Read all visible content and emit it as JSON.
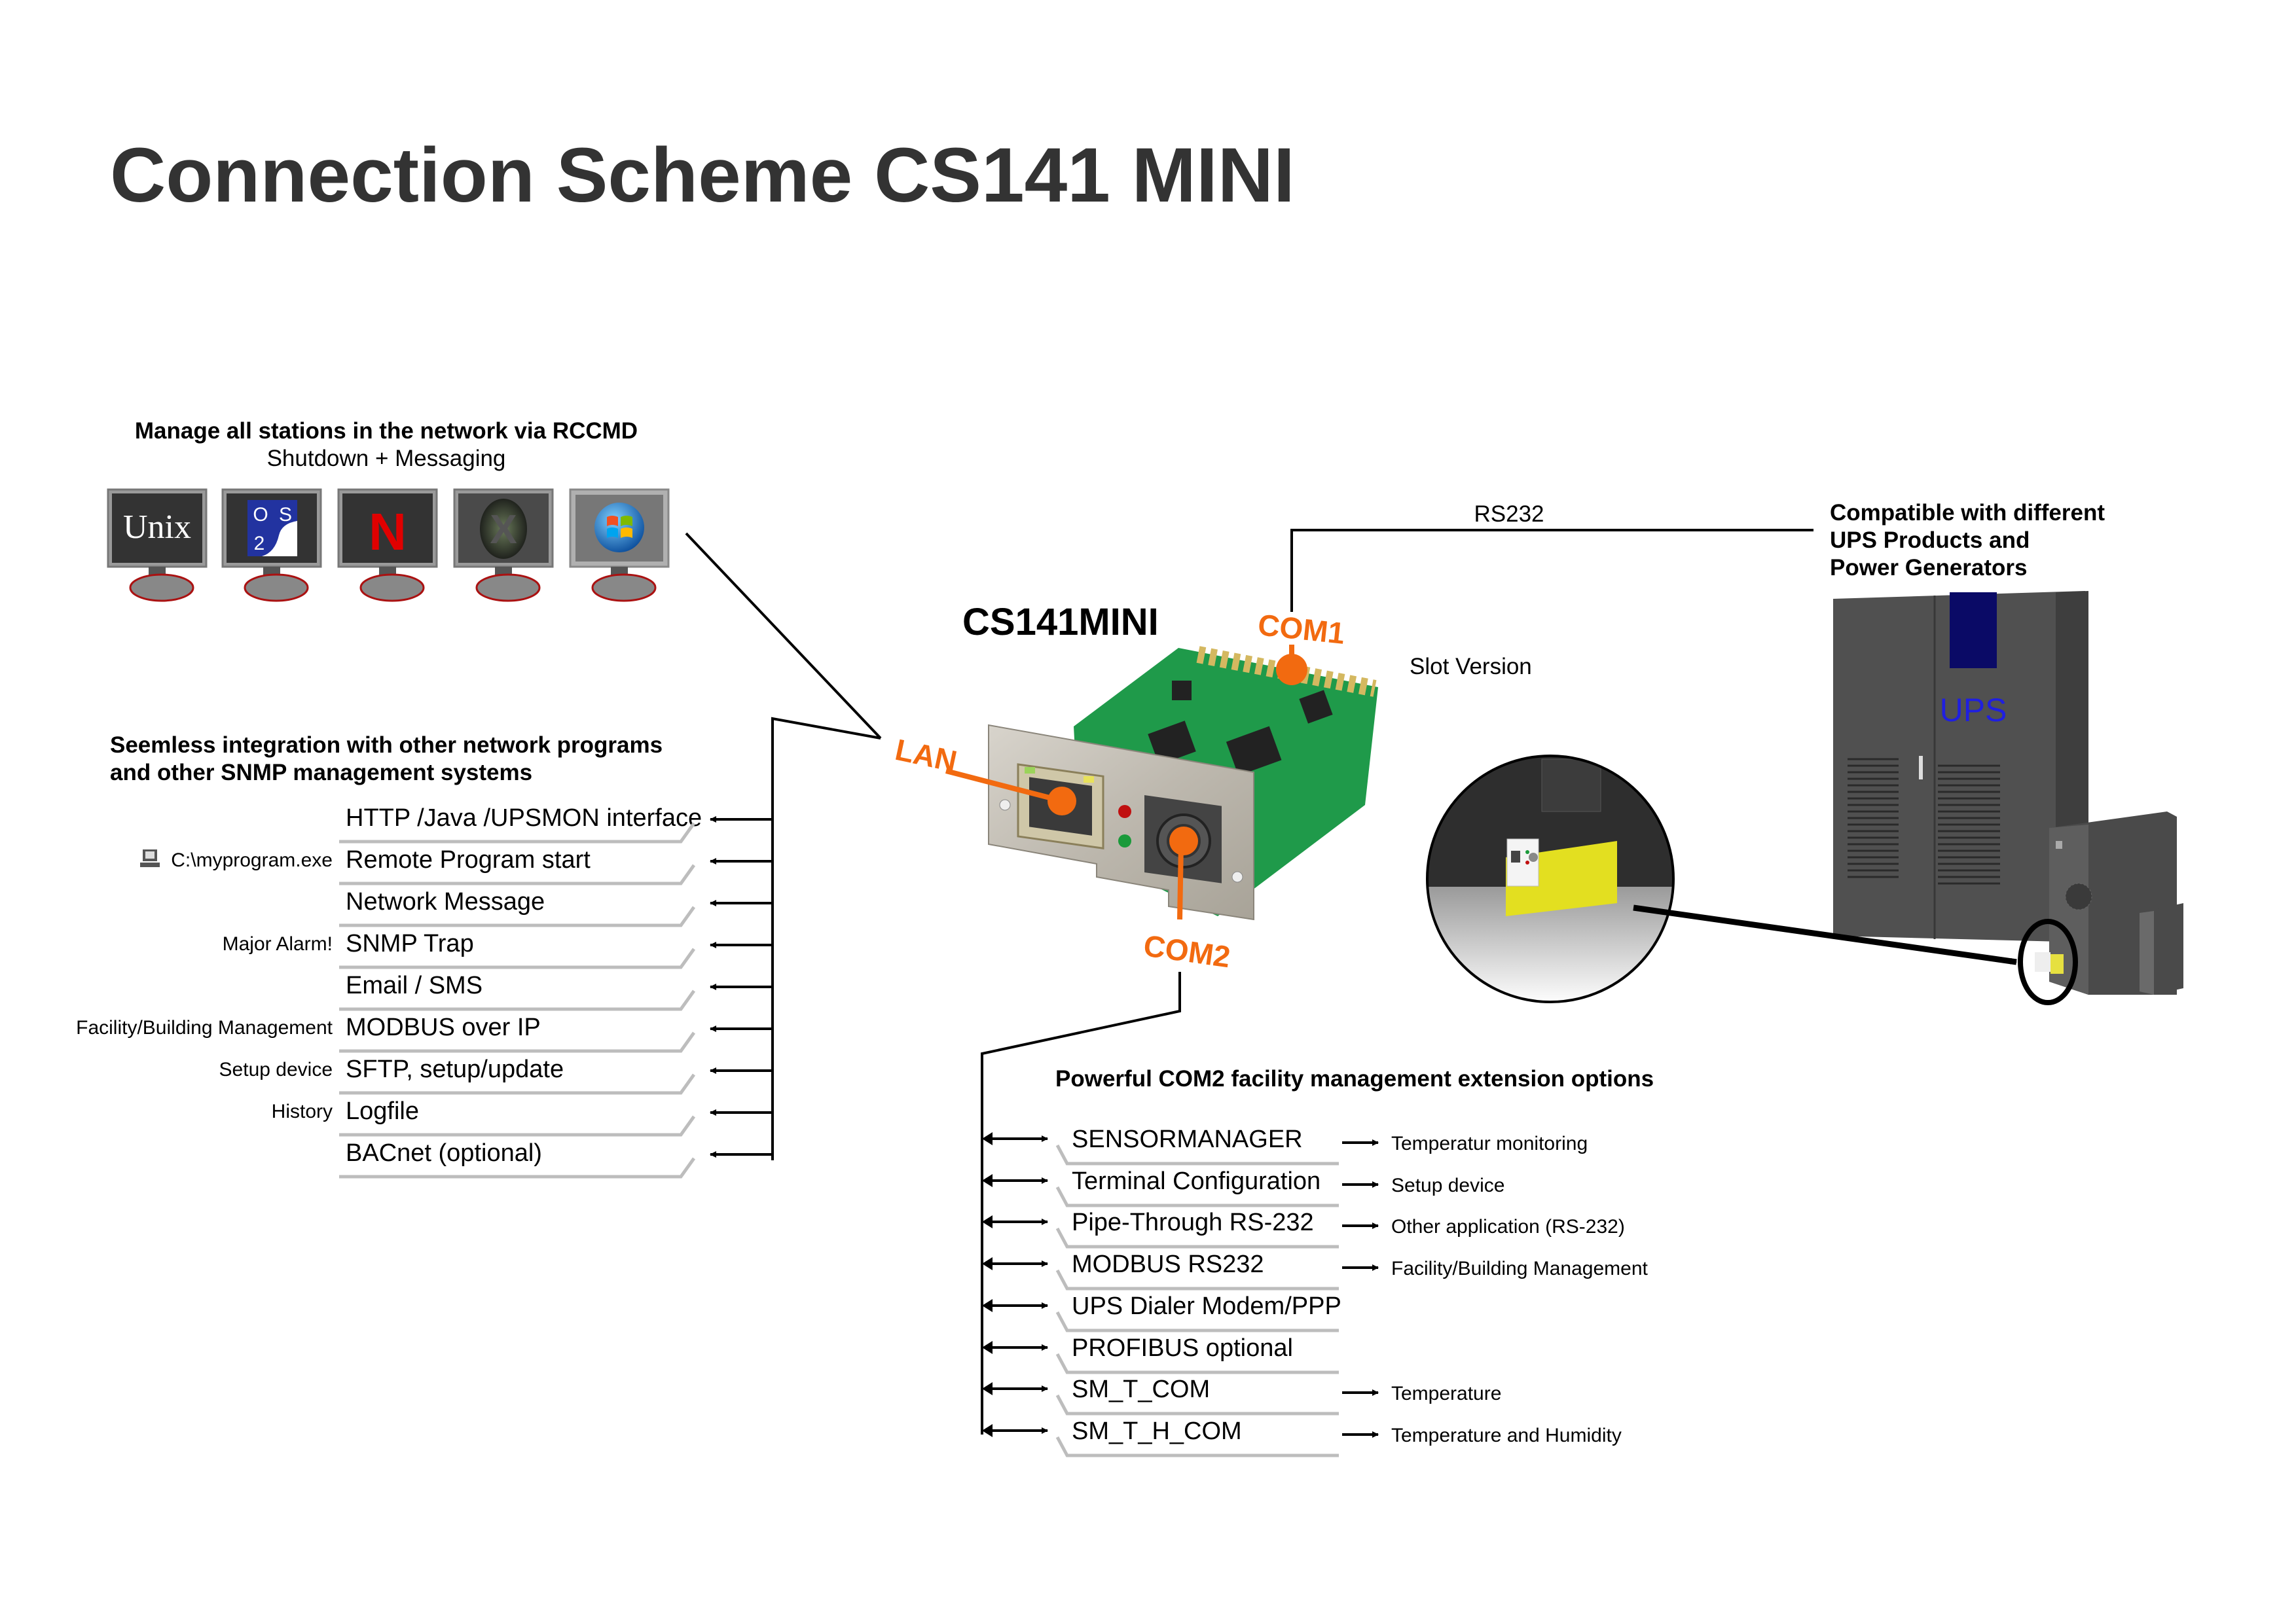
{
  "title": "Connection Scheme CS141 MINI",
  "colors": {
    "accent_orange": "#f26a10",
    "title_gray": "#333333",
    "ups_blue": "#0a0a66",
    "ups_label_blue": "#1f1fe0",
    "pcb_green": "#1f9a4a",
    "underline_gray": "#bdbdbd"
  },
  "rccmd": {
    "heading": "Manage all stations in the network via RCCMD",
    "subheading": "Shutdown + Messaging",
    "stations": [
      {
        "name": "Unix",
        "icon": "unix-logo-icon",
        "label": "Unix"
      },
      {
        "name": "OS/2",
        "icon": "os2-logo-icon",
        "label": "OS 2"
      },
      {
        "name": "NetWare",
        "icon": "novell-netware-logo-icon",
        "label": "N"
      },
      {
        "name": "Mac OS X",
        "icon": "mac-os-x-logo-icon",
        "label": "X"
      },
      {
        "name": "Windows",
        "icon": "windows-logo-icon",
        "label": ""
      }
    ]
  },
  "network": {
    "heading_line1": "Seemless integration with other network programs",
    "heading_line2": "and other SNMP management systems",
    "items": [
      {
        "label": "HTTP /Java /UPSMON interface",
        "note": ""
      },
      {
        "label": "Remote Program start",
        "note": "C:\\myprogram.exe",
        "note_icon": "computer-icon"
      },
      {
        "label": "Network Message",
        "note": ""
      },
      {
        "label": "SNMP Trap",
        "note": "Major Alarm!"
      },
      {
        "label": "Email / SMS",
        "note": ""
      },
      {
        "label": "MODBUS over IP",
        "note": "Facility/Building Management"
      },
      {
        "label": "SFTP, setup/update",
        "note": "Setup device"
      },
      {
        "label": "Logfile",
        "note": "History"
      },
      {
        "label": "BACnet (optional)",
        "note": ""
      }
    ]
  },
  "device": {
    "name": "CS141MINI",
    "ports": {
      "lan": "LAN",
      "com1": "COM1",
      "com2": "COM2"
    },
    "slot_label": "Slot Version",
    "rs232_label": "RS232"
  },
  "ups": {
    "heading_line1": "Compatible with different",
    "heading_line2": "UPS Products and",
    "heading_line3": "Power Generators",
    "cabinet_label": "UPS"
  },
  "com2": {
    "heading": "Powerful COM2 facility management extension options",
    "items": [
      {
        "label": "SENSORMANAGER",
        "target": "Temperatur monitoring"
      },
      {
        "label": "Terminal Configuration",
        "target": "Setup device"
      },
      {
        "label": "Pipe-Through RS-232",
        "target": "Other application (RS-232)"
      },
      {
        "label": "MODBUS RS232",
        "target": "Facility/Building Management"
      },
      {
        "label": "UPS Dialer Modem/PPP",
        "target": ""
      },
      {
        "label": "PROFIBUS optional",
        "target": ""
      },
      {
        "label": "SM_T_COM",
        "target": "Temperature"
      },
      {
        "label": "SM_T_H_COM",
        "target": "Temperature and Humidity"
      }
    ]
  }
}
